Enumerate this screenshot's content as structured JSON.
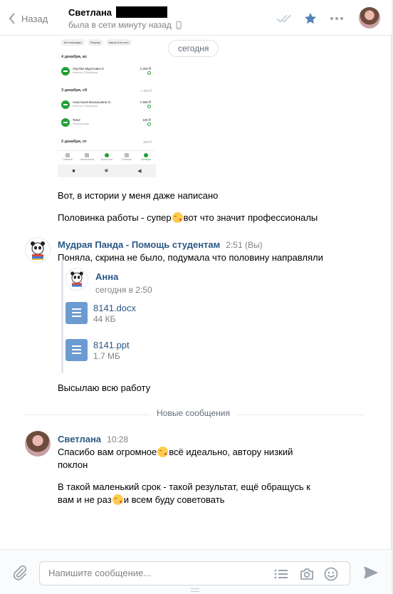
{
  "header": {
    "back_label": "Назад",
    "peer_name": "Светлана",
    "peer_status": "была в сети минуту назад"
  },
  "history": {
    "date_pill": "сегодня",
    "screenshot": {
      "chips": [
        "Тип операции",
        "Период",
        "Карты или счёт"
      ],
      "days": [
        {
          "label": "4 декабря, вс",
          "sum": ""
        },
        {
          "label": "3 декабря, сб",
          "sum": "1 600 ₽"
        },
        {
          "label": "2 декабря, пт",
          "sum": "600 ₽"
        }
      ],
      "transactions": [
        {
          "name": "Улугбек Муротович К.",
          "sub": "Клиенту СберБанка",
          "amount": "2 200 ₽"
        },
        {
          "name": "Анастасия Васильевна О.",
          "sub": "Клиенту СберБанка",
          "amount": "1 500 ₽"
        },
        {
          "name": "Tele2",
          "sub": "Оплата услуг",
          "amount": "100 ₽"
        }
      ],
      "tabs": [
        "Главный",
        "Накопления",
        "Ассистент",
        "Платежи",
        "История"
      ],
      "nav": [
        "■",
        "❋",
        "◀"
      ]
    },
    "msg1": "Вот, в истории у меня даже написано",
    "msg2_before": "Половинка работы - супер",
    "msg2_after": "вот что значит профессионалы",
    "panda_author": "Мудрая Панда - Помощь студентам",
    "panda_time": "2:51 (Вы)",
    "panda_msg": "Поняла, скрина не было, подумала что половину направляли",
    "forward": {
      "author": "Анна",
      "time": "сегодня в 2:50",
      "docs": [
        {
          "name": "8141.docx",
          "size": "44 КБ"
        },
        {
          "name": "8141.ppt",
          "size": "1.7 МБ"
        }
      ]
    },
    "panda_msg2": "Высылаю всю работу",
    "divider_label": "Новые сообщения",
    "svet_author": "Светлана",
    "svet_time": "10:28",
    "svet_msg1_before": "Спасибо вам огромное",
    "svet_msg1_after": "всё идеально, автору низкий",
    "svet_msg1_line2": "поклон",
    "svet_msg2_line1": "В такой маленький срок - такой результат, ещё обращусь к",
    "svet_msg2_before": "вам и не раз",
    "svet_msg2_after": "и всем буду советовать"
  },
  "composer": {
    "placeholder": "Напишите сообщение..."
  },
  "colors": {
    "link": "#2a5885",
    "accent": "#5181b8",
    "muted": "#828282",
    "sber_green": "#21a038"
  },
  "icons": [
    "chevron-left-icon",
    "phone-icon",
    "double-check-icon",
    "star-icon",
    "more-icon",
    "paperclip-icon",
    "list-icon",
    "camera-icon",
    "smile-icon",
    "send-icon",
    "document-icon"
  ]
}
